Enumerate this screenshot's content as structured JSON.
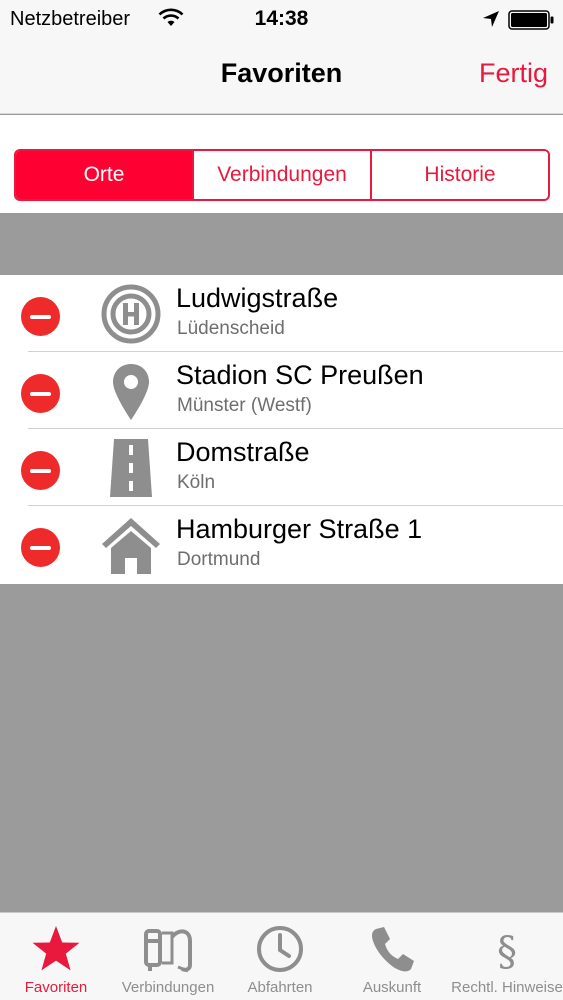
{
  "status_bar": {
    "carrier": "Netzbetreiber",
    "time": "14:38",
    "icons": [
      "wifi-icon",
      "location-arrow-icon",
      "battery-icon"
    ]
  },
  "nav": {
    "title": "Favoriten",
    "done_label": "Fertig"
  },
  "segments": [
    {
      "label": "Orte",
      "selected": true
    },
    {
      "label": "Verbindungen",
      "selected": false
    },
    {
      "label": "Historie",
      "selected": false
    }
  ],
  "favorites": [
    {
      "title": "Ludwigstraße",
      "subtitle": "Lüdenscheid",
      "icon": "bus-stop-icon"
    },
    {
      "title": "Stadion SC Preußen",
      "subtitle": "Münster (Westf)",
      "icon": "map-pin-icon"
    },
    {
      "title": "Domstraße",
      "subtitle": "Köln",
      "icon": "street-icon"
    },
    {
      "title": "Hamburger Straße 1",
      "subtitle": "Dortmund",
      "icon": "house-icon"
    }
  ],
  "tabs": [
    {
      "label": "Favoriten",
      "icon": "star-icon",
      "active": true
    },
    {
      "label": "Verbindungen",
      "icon": "connections-icon",
      "active": false
    },
    {
      "label": "Abfahrten",
      "icon": "clock-icon",
      "active": false
    },
    {
      "label": "Auskunft",
      "icon": "phone-icon",
      "active": false
    },
    {
      "label": "Rechtl. Hinweise",
      "icon": "paragraph-icon",
      "active": false
    }
  ],
  "colors": {
    "accent": "#e8193c",
    "segment_selected": "#ff0033",
    "delete": "#ee2a2a",
    "icon_gray": "#8e8e8e",
    "background_gray": "#9b9b9b"
  }
}
